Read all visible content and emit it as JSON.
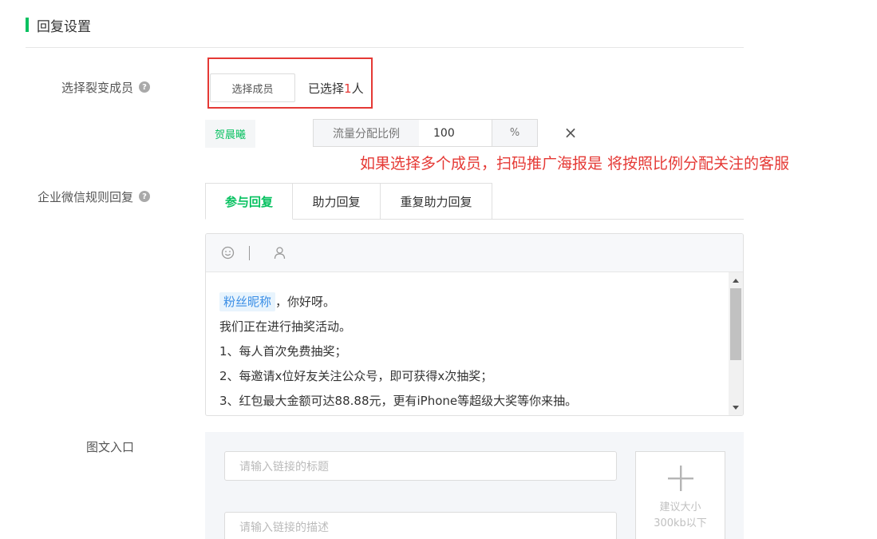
{
  "section": {
    "title": "回复设置"
  },
  "labels": {
    "select_members": "选择裂变成员",
    "wecom_reply": "企业微信规则回复",
    "image_entry": "图文入口"
  },
  "member_select": {
    "button_label": "选择成员",
    "selected_prefix": "已选择",
    "selected_count": "1",
    "selected_suffix": "人"
  },
  "member_row": {
    "name": "贺晨曦",
    "ratio_label": "流量分配比例",
    "ratio_value": "100",
    "ratio_unit": "%",
    "remove": "×"
  },
  "annotation": "如果选择多个成员，扫码推广海报是 将按照比例分配关注的客服",
  "tabs": [
    {
      "label": "参与回复",
      "active": true
    },
    {
      "label": "助力回复",
      "active": false
    },
    {
      "label": "重复助力回复",
      "active": false
    }
  ],
  "editor": {
    "toolbar_icons": [
      "emoji-icon",
      "user-icon"
    ],
    "nickname_tag": "粉丝昵称",
    "first_line_rest": "，你好呀。",
    "lines": [
      "我们正在进行抽奖活动。",
      "1、每人首次免费抽奖；",
      "2、每邀请x位好友关注公众号，即可获得x次抽奖；",
      "3、红包最大金额可达88.88元，更有iPhone等超级大奖等你来抽。"
    ]
  },
  "image_entry": {
    "title_placeholder": "请输入链接的标题",
    "desc_placeholder": "请输入链接的描述",
    "upload_hint_line1": "建议大小",
    "upload_hint_line2": "300kb以下"
  },
  "colors": {
    "accent": "#07c160",
    "alert": "#e53935",
    "tag_blue": "#3a8ee6"
  }
}
